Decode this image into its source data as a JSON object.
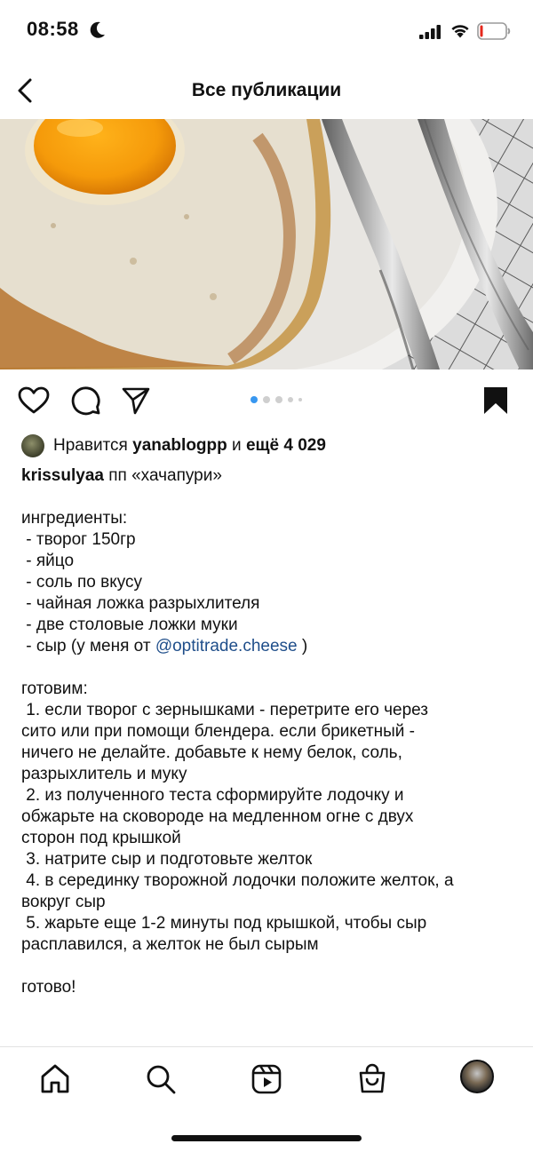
{
  "status": {
    "time": "08:58"
  },
  "header": {
    "title": "Все публикации"
  },
  "carousel": {
    "total": 5,
    "active": 1
  },
  "likes": {
    "prefix": "Нравится",
    "user": "yanablogpp",
    "middle": "и",
    "others": "ещё 4 029"
  },
  "caption": {
    "username": "krissulyaa",
    "title": "пп «хачапури»",
    "ingredients_header": "ингредиенты:",
    "ingredients": [
      " - творог 150гр",
      " - яйцо",
      " - соль по вкусу",
      " - чайная ложка разрыхлителя",
      " - две столовые ложки муки"
    ],
    "cheese_prefix": " - сыр (у меня от ",
    "cheese_mention": "@optitrade.cheese",
    "cheese_suffix": " )",
    "steps_header": "готовим:",
    "steps_lines": [
      " 1. если творог с зернышками - перетрите его через",
      "сито или при помощи блендера. если брикетный -",
      "ничего не делайте. добавьте к нему белок, соль,",
      "разрыхлитель и муку",
      " 2. из полученного теста сформируйте лодочку и",
      "обжарьте на сковороде на медленном огне с двух",
      "сторон под крышкой",
      " 3. натрите сыр и подготовьте желток",
      " 4. в серединку творожной лодочки положите желток, а",
      "вокруг сыр",
      " 5. жарьте еще 1-2 минуты под крышкой, чтобы сыр",
      "расплавился, а желток не был сырым"
    ],
    "ending": "готово!"
  },
  "icons": {
    "back": "chevron-left-icon",
    "like": "heart-icon",
    "comment": "comment-icon",
    "share": "send-icon",
    "save": "bookmark-icon",
    "home": "home-icon",
    "search": "search-icon",
    "reels": "reels-icon",
    "shop": "shop-icon"
  },
  "colors": {
    "accent": "#3897f0",
    "mention": "#1f4e8a",
    "text": "#111111"
  }
}
